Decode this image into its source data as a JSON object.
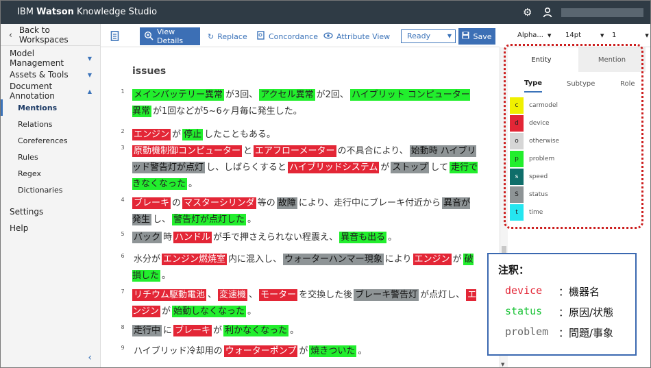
{
  "app": {
    "brand_prefix": "IBM ",
    "brand_bold": "Watson",
    "brand_suffix": " Knowledge Studio"
  },
  "sidebar": {
    "back": "Back to Workspaces",
    "items": [
      {
        "label": "Model Management",
        "caret": "▼"
      },
      {
        "label": "Assets & Tools",
        "caret": "▼"
      },
      {
        "label": "Document Annotation",
        "caret": "▲"
      }
    ],
    "sub_items": [
      "Mentions",
      "Relations",
      "Coreferences",
      "Rules",
      "Regex",
      "Dictionaries"
    ],
    "bottom_items": [
      "Settings",
      "Help"
    ]
  },
  "toolbar": {
    "view_details": "View Details",
    "replace": "Replace",
    "concordance": "Concordance",
    "attribute_view": "Attribute View",
    "status": "Ready",
    "save": "Save"
  },
  "right_toolbar": {
    "sort": "Alpha...",
    "font_size": "14pt",
    "number": "1"
  },
  "document": {
    "title": "issues",
    "paragraphs": [
      {
        "num": "1",
        "parts": [
          [
            "g",
            "メインバッテリー異常"
          ],
          [
            "",
            "が3回、"
          ],
          [
            "g",
            "アクセル異常"
          ],
          [
            "",
            "が2回、"
          ],
          [
            "g",
            "ハイブリット コンピューター異常"
          ],
          [
            "",
            "が1回などが5~6ヶ月毎に発生した。"
          ]
        ]
      },
      {
        "num": "2",
        "parts": [
          [
            "r",
            "エンジン"
          ],
          [
            "",
            "が"
          ],
          [
            "g",
            "停止"
          ],
          [
            "",
            "したこともある。"
          ]
        ]
      },
      {
        "num": "3",
        "parts": [
          [
            "r",
            "原動機制御コンピューター"
          ],
          [
            "",
            "と"
          ],
          [
            "r",
            "エアフローメーター"
          ],
          [
            "",
            "の不具合により、"
          ],
          [
            "s",
            "始動時"
          ],
          [
            "s",
            "ハイブリッド警告灯が点灯"
          ],
          [
            "",
            "し、しばらくすると"
          ],
          [
            "r",
            "ハイブリッドシステム"
          ],
          [
            "",
            "が"
          ],
          [
            "s",
            "ストップ"
          ],
          [
            "",
            "して"
          ],
          [
            "g",
            "走行できなくなった"
          ],
          [
            "",
            "。"
          ]
        ]
      },
      {
        "num": "4",
        "parts": [
          [
            "r",
            "ブレーキ"
          ],
          [
            "",
            "の"
          ],
          [
            "r",
            "マスターシリンダ"
          ],
          [
            "",
            "等の"
          ],
          [
            "s",
            "故障"
          ],
          [
            "",
            "により、走行中にブレーキ付近から"
          ],
          [
            "s",
            "異音が発生"
          ],
          [
            "",
            "し、"
          ],
          [
            "g",
            "警告灯が点灯した"
          ],
          [
            "",
            "。"
          ]
        ]
      },
      {
        "num": "5",
        "parts": [
          [
            "s",
            "バック"
          ],
          [
            "",
            "時"
          ],
          [
            "r",
            "ハンドル"
          ],
          [
            "",
            "が手で押さえられない程震え、"
          ],
          [
            "g",
            "異音も出る"
          ],
          [
            "",
            "。"
          ]
        ]
      },
      {
        "num": "6",
        "parts": [
          [
            "",
            "水分が"
          ],
          [
            "r",
            "エンジン燃焼室"
          ],
          [
            "",
            "内に混入し、"
          ],
          [
            "s",
            "ウォーターハンマー現象"
          ],
          [
            "",
            "により"
          ],
          [
            "r",
            "エンジン"
          ],
          [
            "",
            "が"
          ],
          [
            "g",
            "破損した"
          ],
          [
            "",
            "。"
          ]
        ]
      },
      {
        "num": "7",
        "parts": [
          [
            "r",
            "リチウム駆動電池"
          ],
          [
            "",
            "、"
          ],
          [
            "r",
            "変速機"
          ],
          [
            "",
            "、"
          ],
          [
            "r",
            "モーター"
          ],
          [
            "",
            "を交換した後"
          ],
          [
            "s",
            "ブレーキ警告灯"
          ],
          [
            "",
            "が点灯し、"
          ],
          [
            "r",
            "エンジン"
          ],
          [
            "",
            "が"
          ],
          [
            "g",
            "始動しなくなった"
          ],
          [
            "",
            "。"
          ]
        ]
      },
      {
        "num": "8",
        "parts": [
          [
            "s",
            "走行中"
          ],
          [
            "",
            "に"
          ],
          [
            "r",
            "ブレーキ"
          ],
          [
            "",
            "が"
          ],
          [
            "g",
            "利かなくなった"
          ],
          [
            "",
            "。"
          ]
        ]
      },
      {
        "num": "9",
        "parts": [
          [
            "",
            "ハイブリッド冷却用の"
          ],
          [
            "r",
            "ウォーターポンプ"
          ],
          [
            "",
            "が"
          ],
          [
            "g",
            "焼きついた"
          ],
          [
            "",
            "。"
          ]
        ]
      }
    ]
  },
  "panel": {
    "tabs": [
      "Entity",
      "Mention"
    ],
    "subtabs": [
      "Type",
      "Subtype",
      "Role"
    ],
    "types": [
      {
        "key": "c",
        "name": "carmodel",
        "color": "#f0f000"
      },
      {
        "key": "d",
        "name": "device",
        "color": "#e32636"
      },
      {
        "key": "o",
        "name": "otherwise",
        "color": "#d6d6d6"
      },
      {
        "key": "p",
        "name": "problem",
        "color": "#22ee2d"
      },
      {
        "key": "s",
        "name": "speed",
        "color": "#0f6e6a"
      },
      {
        "key": "S",
        "name": "status",
        "color": "#8e9496"
      },
      {
        "key": "t",
        "name": "time",
        "color": "#25e6f0"
      }
    ]
  },
  "note": {
    "title": "注釈：",
    "rows": [
      {
        "key": "device",
        "value": "：機器名",
        "color": "#e32636"
      },
      {
        "key": "status",
        "value": "：原因/状態",
        "color": "#1ec43a"
      },
      {
        "key": "problem",
        "value": "：問題/事象",
        "color": "#666666"
      }
    ]
  }
}
